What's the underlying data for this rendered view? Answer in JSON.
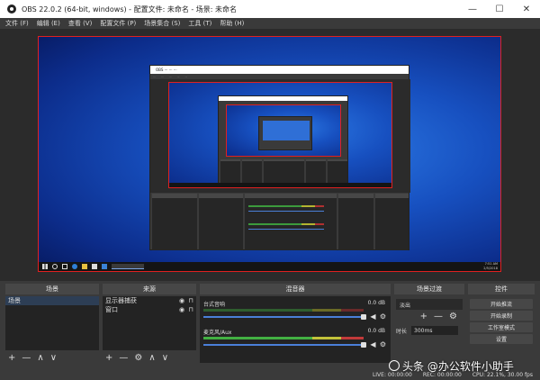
{
  "window": {
    "title": "OBS 22.0.2 (64-bit, windows) - 配置文件: 未命名 - 场景: 未命名",
    "controls": [
      "—",
      "☐",
      "✕"
    ]
  },
  "menu": [
    "文件 (F)",
    "编辑 (E)",
    "查看 (V)",
    "配置文件 (P)",
    "场景集合 (S)",
    "工具 (T)",
    "帮助 (H)"
  ],
  "docks": {
    "scenes": {
      "title": "场景",
      "items": [
        "场景"
      ]
    },
    "sources": {
      "title": "来源",
      "items": [
        "显示器捕获",
        "窗口"
      ]
    },
    "mixer": {
      "title": "混音器",
      "channels": [
        {
          "name": "麦克风/Aux",
          "db": "0.0 dB",
          "level": 0.8
        },
        {
          "name": "台式音响",
          "db": "0.0 dB",
          "level": 0.0
        }
      ]
    },
    "transitions": {
      "title": "场景过渡",
      "selected": "淡出",
      "duration_label": "时长",
      "duration_value": "300ms"
    },
    "controls": {
      "title": "控件",
      "buttons": [
        "开始推流",
        "开始录制",
        "工作室模式",
        "设置"
      ]
    }
  },
  "footer_symbols": {
    "add": "+",
    "remove": "—",
    "up": "∧",
    "down": "∨",
    "gear": "⚙"
  },
  "statusbar": {
    "live": "LIVE: 00:00:00",
    "rec": "REC: 00:00:00",
    "cpu": "CPU: 22.1%, 30.00 fps"
  },
  "desktop_clock": {
    "time": "7:51 AM",
    "date": "2/5/2018"
  },
  "watermark": "头条 @办公软件小助手"
}
